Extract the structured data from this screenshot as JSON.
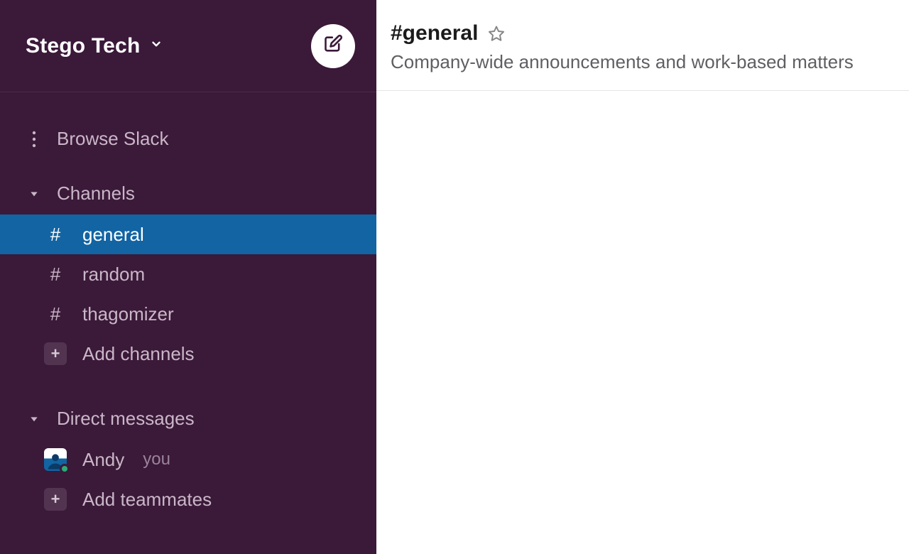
{
  "workspace": {
    "name": "Stego Tech"
  },
  "sidebar": {
    "browse_label": "Browse Slack",
    "channels_section": "Channels",
    "channels": [
      {
        "name": "general",
        "selected": true
      },
      {
        "name": "random",
        "selected": false
      },
      {
        "name": "thagomizer",
        "selected": false
      }
    ],
    "add_channels_label": "Add channels",
    "dm_section": "Direct messages",
    "dms": [
      {
        "name": "Andy",
        "you": true,
        "you_label": "you"
      }
    ],
    "add_teammates_label": "Add teammates"
  },
  "channel_header": {
    "name": "#general",
    "topic": "Company-wide announcements and work-based matters"
  },
  "colors": {
    "sidebar_bg": "#3b1939",
    "selected_bg": "#1264a3",
    "presence_green": "#2bac76"
  }
}
